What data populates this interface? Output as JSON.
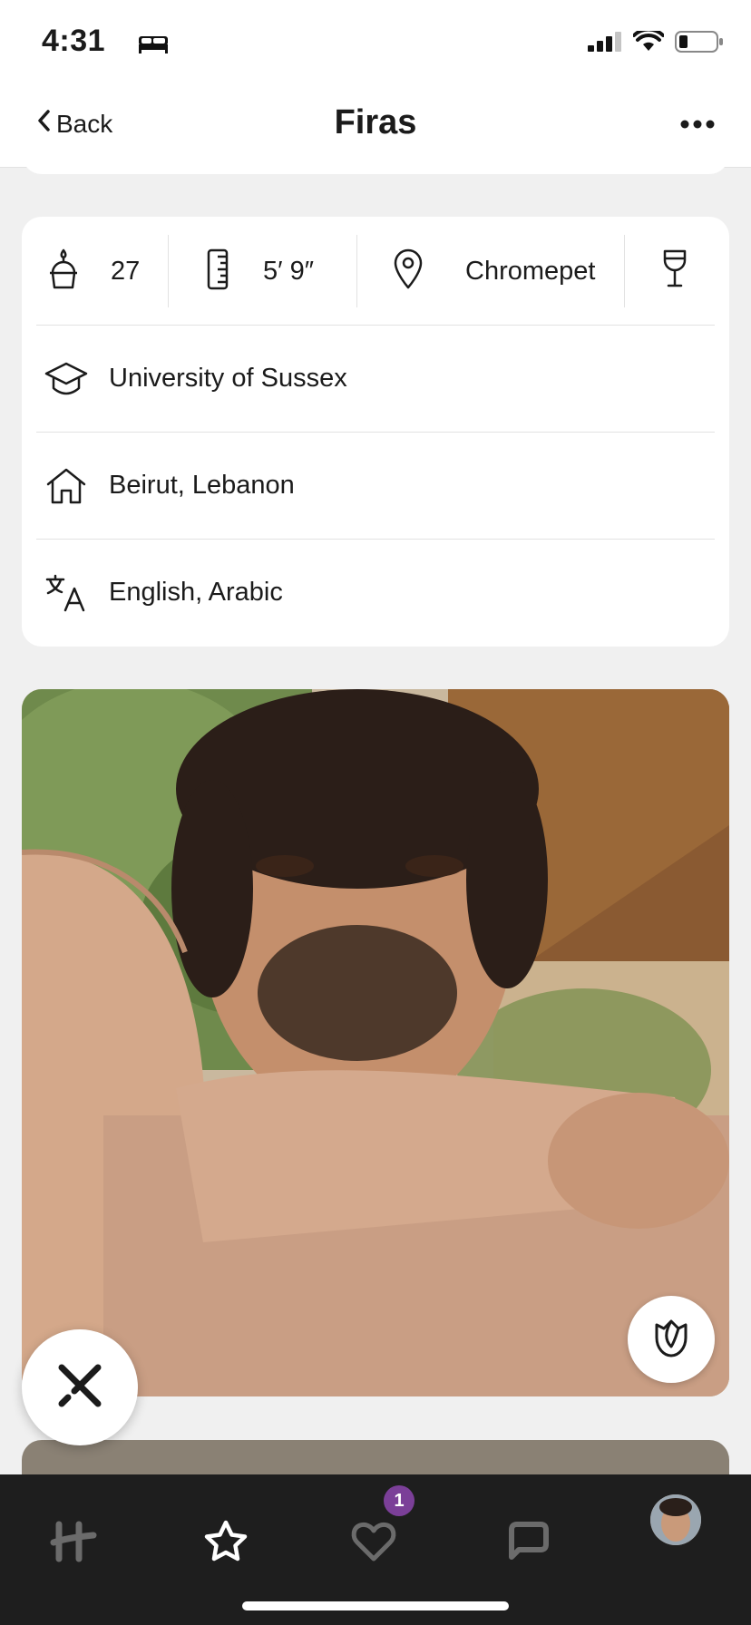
{
  "status_bar": {
    "time": "4:31"
  },
  "nav": {
    "back_label": "Back",
    "title": "Firas"
  },
  "stats": {
    "age": "27",
    "height": "5′ 9″",
    "location": "Chromepet"
  },
  "details": {
    "education": "University of Sussex",
    "hometown": "Beirut, Lebanon",
    "languages": "English, Arabic"
  },
  "tab_bar": {
    "likes_badge": "1"
  },
  "icons": {
    "age": "birthday-cake-icon",
    "height": "ruler-icon",
    "location": "map-pin-icon",
    "drinking": "wine-glass-icon",
    "education": "graduation-cap-icon",
    "hometown": "house-icon",
    "languages": "translate-icon"
  },
  "colors": {
    "badge": "#7b3f98",
    "tab_bar_bg": "#1e1e1e",
    "background": "#f0f0f0"
  }
}
